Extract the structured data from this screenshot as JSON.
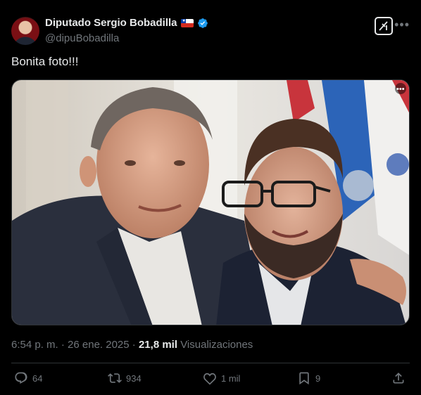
{
  "author": {
    "display_name": "Diputado Sergio Bobadilla",
    "handle": "@dipuBobadilla",
    "flag_icon": "chile-flag-icon",
    "verified_icon": "verified-badge-icon",
    "verified_color": "#1d9bf0"
  },
  "post": {
    "text": "Bonita foto!!!",
    "timestamp": "6:54 p. m. · 26 ene. 2025",
    "separator": " · ",
    "views_count": "21,8 mil",
    "views_label": "Visualizaciones"
  },
  "actions": {
    "replies": "64",
    "reposts": "934",
    "likes": "1 mil",
    "bookmarks": "9"
  },
  "colors": {
    "background": "#000000",
    "text_primary": "#e7e9ea",
    "text_secondary": "#71767b",
    "divider": "#2f3336"
  }
}
